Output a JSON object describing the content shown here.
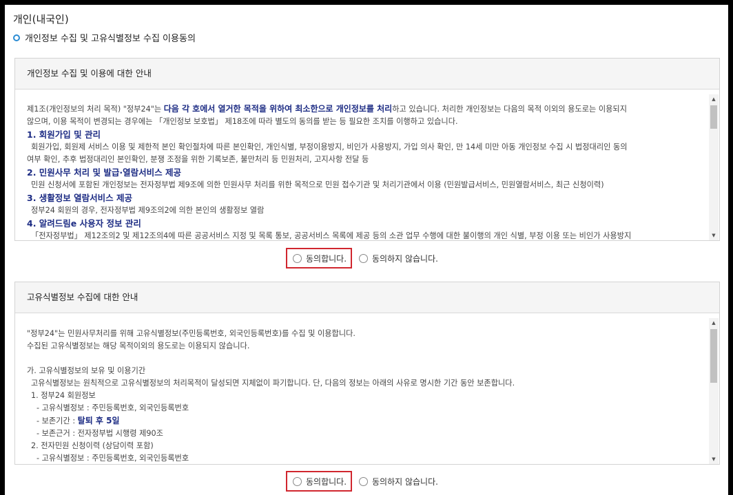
{
  "page": {
    "title": "개인(내국인)",
    "section_heading": "개인정보 수집 및 고유식별정보 수집 이용동의"
  },
  "privacy_box": {
    "header": "개인정보 수집 및 이용에 대한 안내",
    "intro_1": "제1조(개인정보의 처리 목적) \"정부24\"는 ",
    "intro_hl": "다음 각 호에서 열거한 목적을 위하여 최소한으로 개인정보를 처리",
    "intro_2": "하고 있습니다. 처리한 개인정보는 다음의 목적 이외의 용도로는 이용되지",
    "intro_3": "않으며, 이용 목적이 변경되는 경우에는 「개인정보 보호법」 제18조에 따라 별도의 동의를 받는 등 필요한 조치를 이행하고 있습니다.",
    "item1_title": "1. 회원가입 및 관리",
    "item1_text_1": "회원가입, 회원제 서비스 이용 및 제한적 본인 확인절차에 따른 본인확인, 개인식별, 부정이용방지, 비인가 사용방지, 가입 의사 확인, 만 14세 미만 아동 개인정보 수집 시 법정대리인 동의",
    "item1_text_2": "여부 확인, 추후 법정대리인 본인확인, 분쟁 조정을 위한 기록보존, 불만처리 등 민원처리, 고지사항 전달 등",
    "item2_title": "2. 민원사무 처리 및 발급·열람서비스 제공",
    "item2_text": "민원 신청서에 포함된 개인정보는 전자정부법 제9조에 의한 민원사무 처리를 위한 목적으로 민원 접수기관 및 처리기관에서 이용 (민원발급서비스, 민원열람서비스, 최근 신청이력)",
    "item3_title": "3. 생활정보 열람서비스 제공",
    "item3_text": "정부24 회원의 경우, 전자정부법 제9조의2에 의한 본인의 생활정보 열람",
    "item4_title": "4. 알려드림e 사용자 정보 관리",
    "item4_text": "「전자정부법」 제12조의2 및 제12조의4에 따른 공공서비스 지정 및 목록 통보, 공공서비스 목록에 제공 등의 소관 업무 수행에 대한 불이행의 개인 식별, 부정 이용 또는 비인가 사용방지"
  },
  "privacy_consent": {
    "agree_label": "동의합니다.",
    "disagree_label": "동의하지 않습니다."
  },
  "unique_id_box": {
    "header": "고유식별정보 수집에 대한 안내",
    "line_1": "\"정부24\"는 민원사무처리를 위해 고유식별정보(주민등록번호, 외국인등록번호)를 수집 및 이용합니다.",
    "line_2": "수집된 고유식별정보는 해당 목적이외의 용도로는 이용되지 않습니다.",
    "sub_a": "가. 고유식별정보의 보유 및 이용기간",
    "sub_a_text": "고유식별정보는 원칙적으로 고유식별정보의 처리목적이 달성되면 지체없이 파기합니다. 단, 다음의 정보는 아래의 사유로 명시한 기간 동안 보존합니다.",
    "n1": "1. 정부24 회원정보",
    "n1_info": "- 고유식별정보 : 주민등록번호, 외국인등록번호",
    "n1_period_label": "- 보존기간 : ",
    "n1_period_value": "탈퇴 후 5일",
    "n1_basis": "- 보존근거 : 전자정부법 시행령 제90조",
    "n2": "2. 전자민원 신청이력 (상담이력 포함)",
    "n2_info": "- 고유식별정보 : 주민등록번호, 외국인등록번호"
  },
  "unique_id_consent": {
    "agree_label": "동의합니다.",
    "disagree_label": "동의하지 않습니다."
  },
  "colors": {
    "heading_blue": "#1d2c84",
    "highlight_red": "#d0262e",
    "bullet_blue": "#2a8bd3"
  }
}
